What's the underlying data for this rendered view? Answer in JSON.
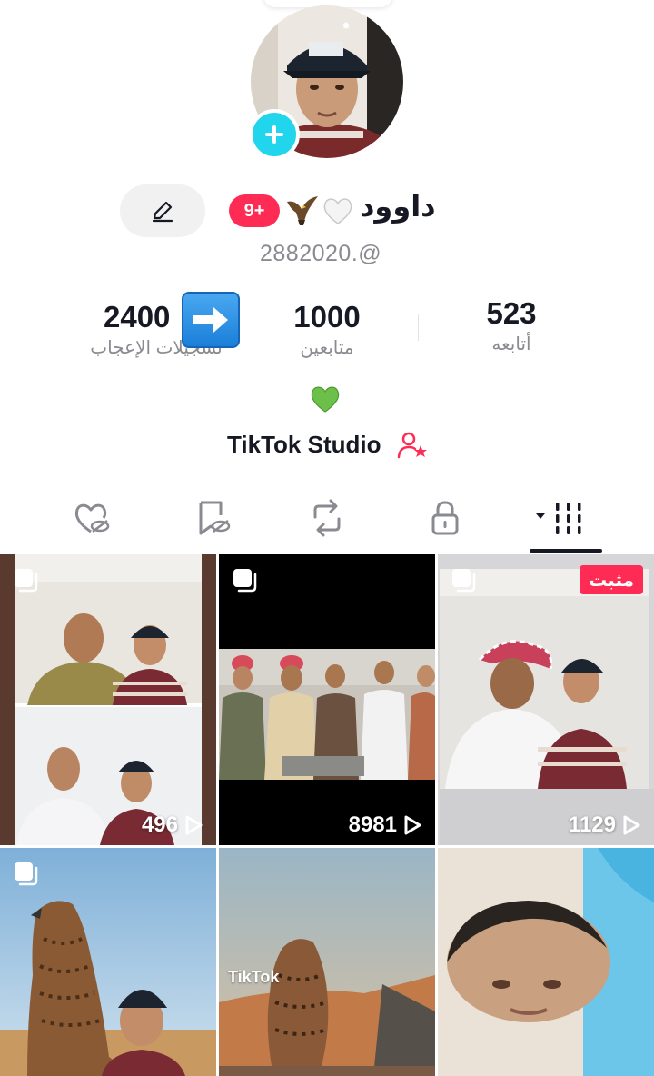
{
  "profile": {
    "display_name": "داوود",
    "notification_badge": "9+",
    "username": "2882020.@",
    "bio_emoji": "💚",
    "name_emojis": [
      "🤍",
      "🦅"
    ]
  },
  "stats": {
    "likes": {
      "value": "2400",
      "label": "تسجيلات الإعجاب"
    },
    "followers": {
      "value": "1000",
      "label": "متابعين"
    },
    "following": {
      "value": "523",
      "label": "أتابعه"
    }
  },
  "studio": {
    "label": "TikTok Studio"
  },
  "tabs": [
    {
      "name": "liked-videos",
      "icon": "heart-eye-slash-icon"
    },
    {
      "name": "favorites",
      "icon": "bookmark-eye-slash-icon"
    },
    {
      "name": "reposts",
      "icon": "repost-icon"
    },
    {
      "name": "private",
      "icon": "lock-icon"
    },
    {
      "name": "videos",
      "icon": "grid-icon",
      "active": true
    }
  ],
  "videos": [
    {
      "views": "496",
      "multi": true,
      "pinned": false
    },
    {
      "views": "8981",
      "multi": true,
      "pinned": false
    },
    {
      "views": "1129",
      "multi": true,
      "pinned": true,
      "pinned_label": "مثبت"
    },
    {
      "views": "",
      "multi": true,
      "pinned": false
    },
    {
      "views": "",
      "multi": false,
      "pinned": false,
      "watermark": "TikTok"
    },
    {
      "views": "",
      "multi": false,
      "pinned": false
    }
  ],
  "colors": {
    "accent_red": "#fe2c55",
    "accent_cyan": "#20d5ec",
    "text_primary": "#161823",
    "text_secondary": "#8a8b91"
  }
}
